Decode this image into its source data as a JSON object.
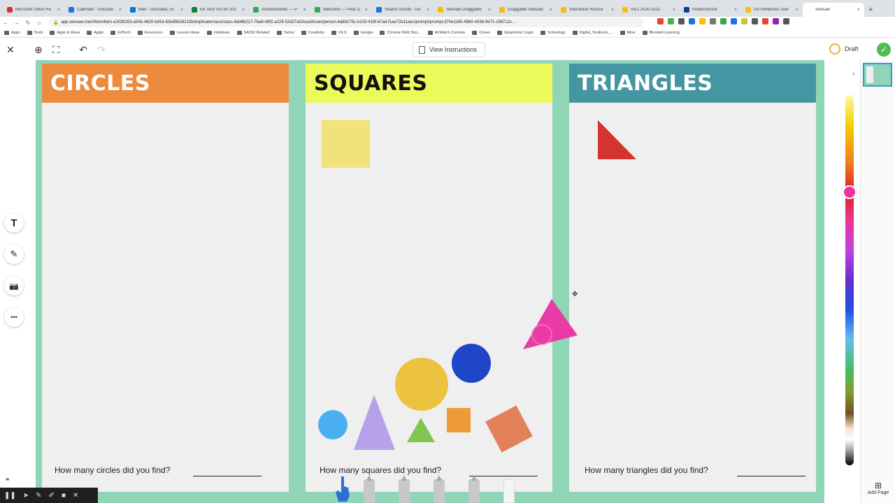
{
  "browser": {
    "tabs": [
      {
        "title": "Microsoft Office Ho",
        "color": "#d93025"
      },
      {
        "title": "Calendar - Gonzale",
        "color": "#1a73e8"
      },
      {
        "title": "Mail - Gonzales, Er",
        "color": "#0078d4"
      },
      {
        "title": "Ed Tech PD for 202",
        "color": "#188038"
      },
      {
        "title": "Achievements — P",
        "color": "#34a853"
      },
      {
        "title": "Welcome — Pear D",
        "color": "#34a853"
      },
      {
        "title": "Search results - Go",
        "color": "#1a73e8"
      },
      {
        "title": "Seesaw Draggable",
        "color": "#fbbc04"
      },
      {
        "title": "Draggable Seesaw",
        "color": "#fbbc04"
      },
      {
        "title": "Interactive Resour",
        "color": "#fbbc04"
      },
      {
        "title": "VILs 2020-2021 -",
        "color": "#fbbc04"
      },
      {
        "title": "PowerSchool",
        "color": "#0b3d91"
      },
      {
        "title": "PD Reflection Jour",
        "color": "#fbbc04"
      },
      {
        "title": "Seesaw",
        "color": "#ffffff"
      }
    ],
    "new_tab": "+",
    "url": "app.seesaw.me/#/item/item.e2038153-a54b-4820-bd16-63e65626210b/duplicate/class/class.6dd4b217-7ba8-49f2-a228-52d27a02cea3/user/person.4a6b175c-b103-419f-b7ad-f1ae72e11aec/prompt/prompt.d70e1180-49b0-4338-9b71-c58712c...",
    "bookmarks": [
      "Apps",
      "Tools",
      "Apps & Ideas",
      "Apple",
      "EdTech",
      "Resources",
      "Lesson Ideas",
      "Initiatives",
      "SAISD Related",
      "Twinsi",
      "Creativity",
      "VILS",
      "Google",
      "Chrome Web Stor...",
      "AirWatch Console",
      "Clever",
      "Eduphoria! Login",
      "Schoology",
      "Digital_Textbook_...",
      "Mine",
      "Blended Learning"
    ]
  },
  "toolbar": {
    "close": "✕",
    "zoom": "⊕",
    "fit": "⛶",
    "undo": "↶",
    "redo": "↷",
    "view_instructions": "View Instructions",
    "draft": "Draft",
    "done": "✓"
  },
  "panels": [
    {
      "title": "CIRCLES",
      "color": "#ec8a3e",
      "text_color": "#ffffff",
      "question": "How many circles did you find?"
    },
    {
      "title": "SQUARES",
      "color": "#ebf95a",
      "text_color": "#111111",
      "question": "How many squares did you find?"
    },
    {
      "title": "TRIANGLES",
      "color": "#4497a2",
      "text_color": "#ffffff",
      "question": "How many triangles did you find?"
    }
  ],
  "tools": {
    "text": "T",
    "pen": "✎",
    "camera": "📷",
    "more": "•••"
  },
  "shapes": {
    "yellow_square": "#f1e27a",
    "red_triangle": "#d43330",
    "pink_triangle": "#ea3aa6",
    "blue_circle": "#1f45c8",
    "yellow_circle": "#ecc23f",
    "light_blue_circle": "#4aaff0",
    "lavender_triangle": "#b7a1e8",
    "green_triangle": "#80c650",
    "orange_square": "#ed9a3a",
    "orange_rotated_square": "#e3825a"
  },
  "sidebar": {
    "add_page": "Add Page"
  },
  "recorder": {
    "quote": "❞"
  }
}
